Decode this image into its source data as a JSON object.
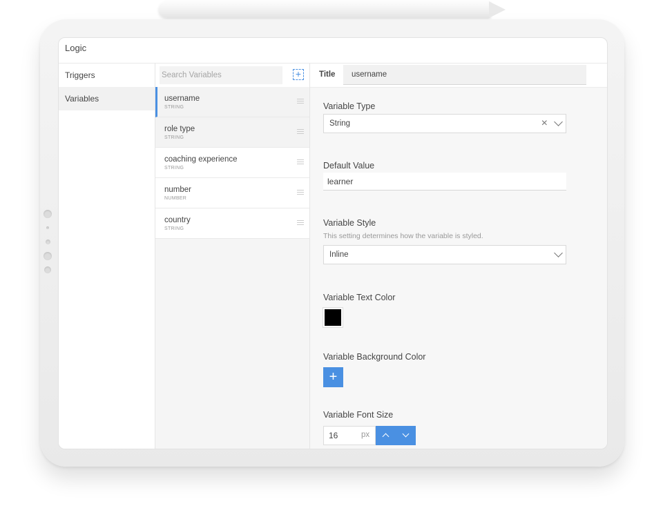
{
  "app": {
    "title": "Logic"
  },
  "nav": {
    "items": [
      {
        "label": "Triggers"
      },
      {
        "label": "Variables"
      }
    ]
  },
  "variables": {
    "search_placeholder": "Search Variables",
    "add_icon": "plus-icon",
    "items": [
      {
        "name": "username",
        "type": "STRING"
      },
      {
        "name": "role type",
        "type": "STRING"
      },
      {
        "name": "coaching experience",
        "type": "STRING"
      },
      {
        "name": "number",
        "type": "NUMBER"
      },
      {
        "name": "country",
        "type": "STRING"
      }
    ]
  },
  "panel": {
    "title_label": "Title",
    "title_value": "username",
    "variable_type": {
      "label": "Variable Type",
      "value": "String"
    },
    "default_value": {
      "label": "Default Value",
      "value": "learner"
    },
    "variable_style": {
      "label": "Variable Style",
      "description": "This setting determines how the variable is styled.",
      "value": "Inline"
    },
    "text_color": {
      "label": "Variable Text Color",
      "value": "#000000"
    },
    "background_color": {
      "label": "Variable Background Color",
      "add_symbol": "+"
    },
    "font_size": {
      "label": "Variable Font Size",
      "value": "16",
      "unit": "px"
    }
  },
  "colors": {
    "accent": "#4a90e2",
    "active_row": "#f3f3f3"
  }
}
